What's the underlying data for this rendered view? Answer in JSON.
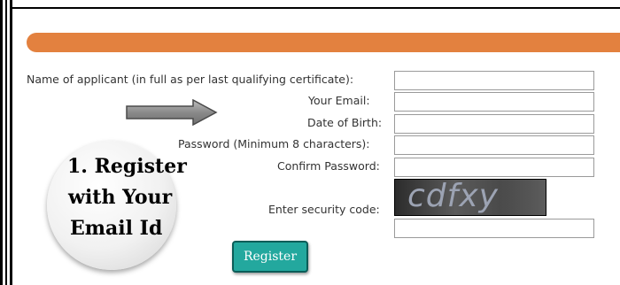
{
  "form": {
    "name_label": "Name of applicant (in full as per last qualifying certificate):",
    "email_label": "Your Email:",
    "dob_label": "Date of Birth:",
    "password_label": "Password (Minimum 8 characters):",
    "confirm_password_label": "Confirm Password:",
    "security_label": "Enter security code:",
    "name_value": "",
    "email_value": "",
    "dob_value": "",
    "password_value": "",
    "confirm_password_value": "",
    "security_value": ""
  },
  "captcha": {
    "text": "cdfxy"
  },
  "callout": {
    "line1": "1. Register",
    "line2": "with Your",
    "line3": "Email Id"
  },
  "buttons": {
    "register_label": "Register"
  },
  "colors": {
    "banner": "#e3813f",
    "register_button": "#23a89e"
  },
  "icons": {
    "arrow": "right-arrow-icon"
  }
}
